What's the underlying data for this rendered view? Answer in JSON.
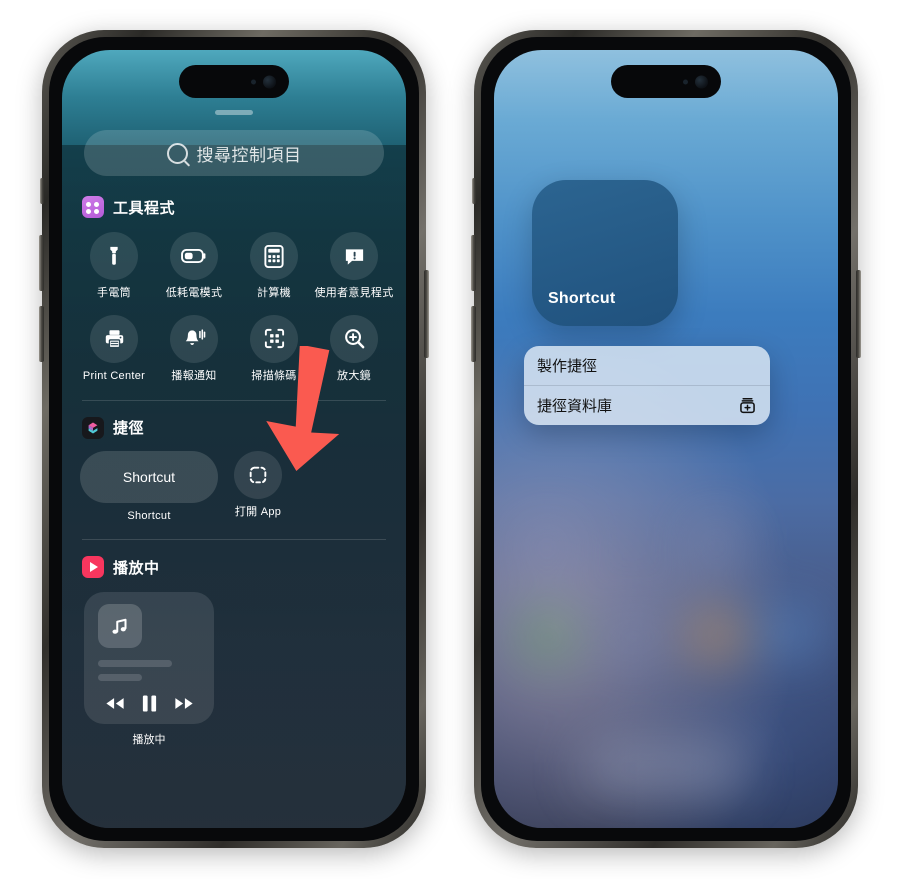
{
  "left_phone": {
    "screen_name": "control-center",
    "search": {
      "placeholder": "搜尋控制項目",
      "icon": "search-icon"
    },
    "sections": [
      {
        "id": "utilities",
        "title": "工具程式",
        "icon": "utilities-grid-icon",
        "icon_color": "#c36ce0",
        "controls": [
          {
            "label": "手電筒",
            "icon": "flashlight-icon"
          },
          {
            "label": "低耗電模式",
            "icon": "battery-low-power-icon"
          },
          {
            "label": "計算機",
            "icon": "calculator-icon"
          },
          {
            "label": "使用者意見程式",
            "icon": "feedback-icon"
          },
          {
            "label": "Print Center",
            "icon": "printer-icon"
          },
          {
            "label": "播報通知",
            "icon": "announce-notifications-icon"
          },
          {
            "label": "掃描條碼",
            "icon": "scan-code-icon"
          },
          {
            "label": "放大鏡",
            "icon": "magnifier-icon"
          }
        ]
      },
      {
        "id": "shortcuts",
        "title": "捷徑",
        "icon": "shortcuts-app-icon",
        "controls": [
          {
            "label": "Shortcut",
            "tile_label": "Shortcut",
            "icon": "shortcut-widget"
          },
          {
            "label": "打開 App",
            "icon": "open-app-icon"
          }
        ]
      },
      {
        "id": "now-playing",
        "title": "播放中",
        "icon": "now-playing-icon",
        "icon_color": "#f8365e",
        "card": {
          "label": "播放中",
          "artwork_icon": "music-note-icon",
          "controls": [
            {
              "name": "rewind",
              "icon": "rewind-icon"
            },
            {
              "name": "pause",
              "icon": "pause-icon"
            },
            {
              "name": "forward",
              "icon": "forward-icon"
            }
          ]
        }
      }
    ]
  },
  "right_phone": {
    "screen_name": "home-screen",
    "widget": {
      "label": "Shortcut",
      "name": "shortcut-widget"
    },
    "context_menu": [
      {
        "label": "製作捷徑",
        "icon": null
      },
      {
        "label": "捷徑資料庫",
        "icon": "add-to-library-icon"
      }
    ]
  },
  "annotation": {
    "arrow_color": "#fa5a50",
    "points_to": "捷徑"
  }
}
